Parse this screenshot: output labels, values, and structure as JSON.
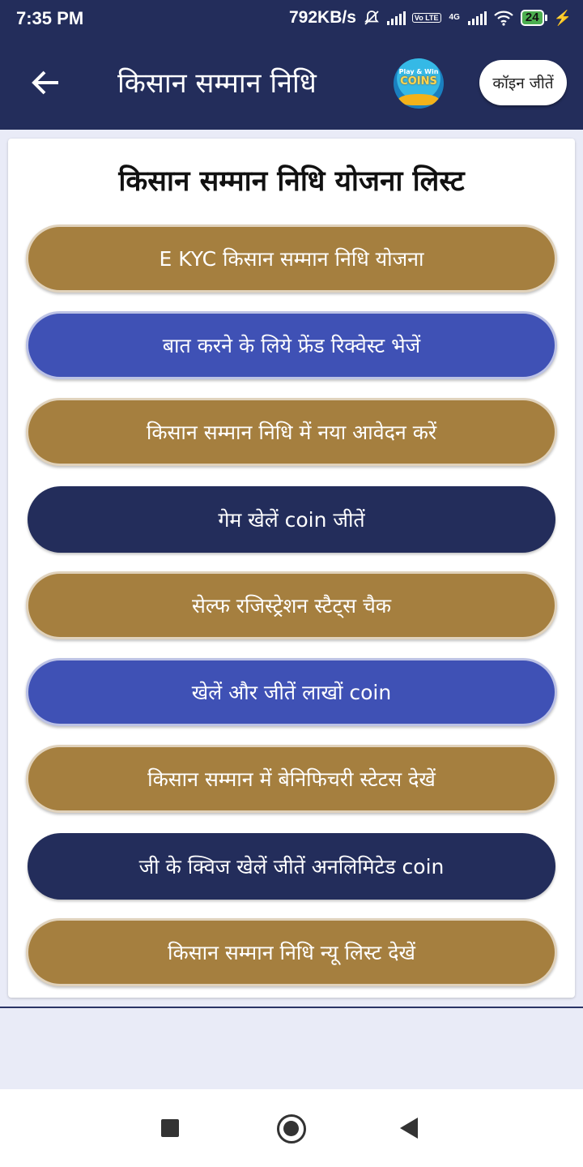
{
  "status_bar": {
    "time": "7:35 PM",
    "speed": "792KB/s",
    "volte": "Vo LTE",
    "net": "4G",
    "battery": "24"
  },
  "app_bar": {
    "title": "किसान सम्मान निधि",
    "logo": {
      "top_text": "Play & Win",
      "main_text": "COINS"
    },
    "coin_button": "कॉइन जीतें"
  },
  "card": {
    "title": "किसान सम्मान निधि योजना लिस्ट",
    "buttons": [
      {
        "label": "E KYC किसान सम्मान निधि योजना",
        "color": "#a57f3f"
      },
      {
        "label": "बात करने के लिये फ्रेंड रिक्वेस्ट भेजें",
        "color": "#3f51b5"
      },
      {
        "label": "किसान सम्मान निधि में नया आवेदन करें",
        "color": "#a57f3f"
      },
      {
        "label": "गेम खेलें coin जीतें",
        "color": "#232d5b"
      },
      {
        "label": "सेल्फ रजिस्ट्रेशन स्टैट्स चैक",
        "color": "#a57f3f"
      },
      {
        "label": "खेलें और जीतें लाखों coin",
        "color": "#3f51b5"
      },
      {
        "label": "किसान सम्मान में बेनिफिचरी स्टेटस देखें",
        "color": "#a57f3f"
      },
      {
        "label": "जी के क्विज खेलें जीतें अनलिमिटेड coin",
        "color": "#232d5b"
      },
      {
        "label": "किसान सम्मान निधि न्यू लिस्ट देखें",
        "color": "#a57f3f"
      }
    ]
  },
  "icons": {
    "back": "arrow-left-icon",
    "nav_recent": "square-icon",
    "nav_home": "circle-icon",
    "nav_back": "triangle-back-icon"
  }
}
